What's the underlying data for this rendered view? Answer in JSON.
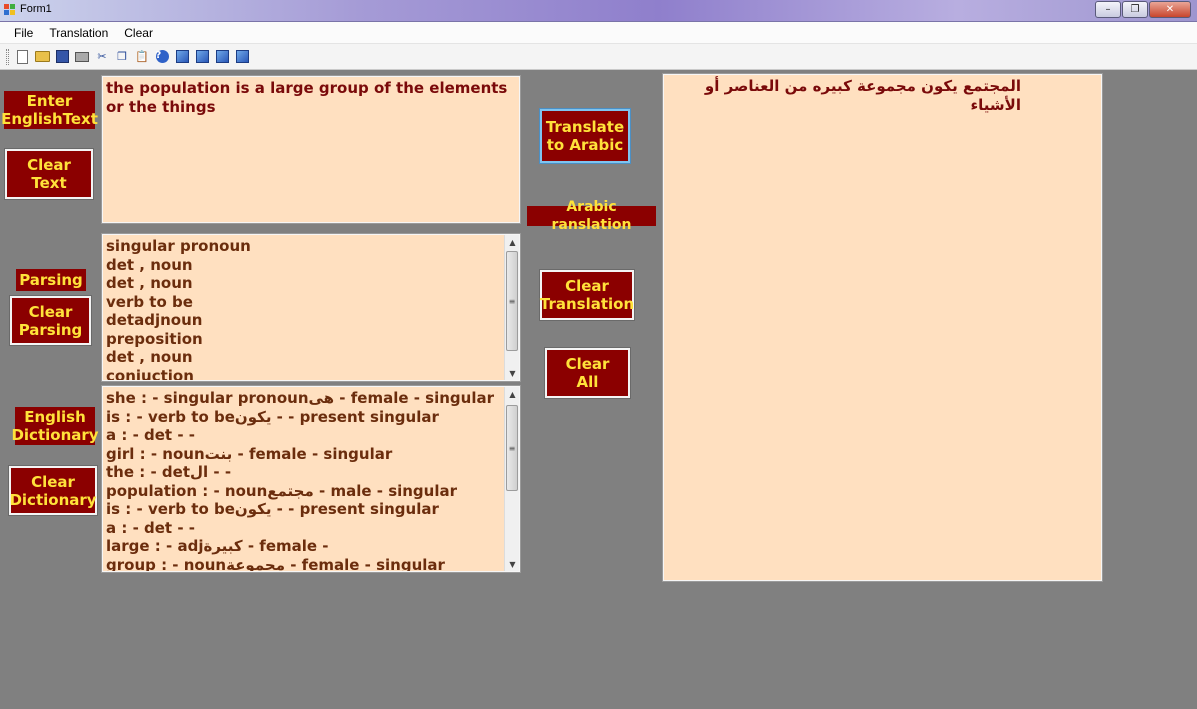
{
  "window": {
    "title": "Form1",
    "minimize": "–",
    "restore": "❐",
    "close": "✕"
  },
  "menu": [
    "File",
    "Translation",
    "Clear"
  ],
  "toolbar": {
    "icons": [
      "new-file-icon",
      "open-folder-icon",
      "save-icon",
      "print-icon",
      "cut-icon",
      "copy-icon",
      "paste-icon",
      "help-icon",
      "image-icon",
      "image-icon",
      "image-icon",
      "image-icon"
    ]
  },
  "left": {
    "enter_label": "Enter\nEnglishText",
    "clear_text": "Clear\nText",
    "parsing_label": "Parsing",
    "clear_parsing": "Clear\nParsing",
    "dictionary_label": "English\nDictionary",
    "clear_dictionary": "Clear\nDictionary"
  },
  "middle": {
    "translate_button": "Translate\nto Arabic",
    "arabic_label": "Arabic ranslation",
    "clear_translation": "Clear\nTranslation",
    "clear_all": "Clear\nAll"
  },
  "english_text": "the population is a large group of the elements or the things",
  "parsing_lines": [
    "singular pronoun",
    "det , noun",
    "det , noun",
    "verb to be",
    "detadjnoun",
    "preposition",
    "det , noun",
    "conjuction"
  ],
  "dictionary_lines": [
    "she :   -  singular pronounهى -  female  -   singular",
    "is :   -  verb to beيكون -     - present  singular",
    "a :   -  det -    -",
    "girl :   -  nounبنت -  female  -   singular",
    "the :   -  detال -    -",
    "population :   -  nounمجتمع -  male  -   singular",
    "is :   -  verb to beيكون -     - present  singular",
    "a :   -  det -    -",
    "large :   -  adjكبيرة -  female  -",
    "group :   -  nounمجموعة -  female  -   singular"
  ],
  "arabic_text": "المجتمع  يكون  مجموعة كبيره  من  العناصر  أو  الأشياء",
  "colors": {
    "button_bg": "#8b0000",
    "button_text": "#ffe23a",
    "panel_bg": "#ffe0c0",
    "form_bg": "#808080"
  }
}
